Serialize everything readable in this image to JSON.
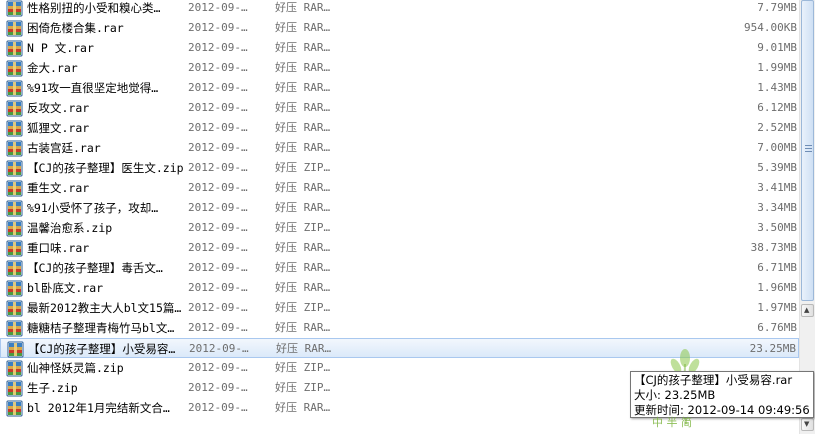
{
  "files": [
    {
      "name": "性格别扭的小受和糗心类…",
      "date": "2012-09-…",
      "type": "好压 RAR…",
      "size": "7.79MB",
      "icon": "rar-archive-icon"
    },
    {
      "name": "困倚危楼合集.rar",
      "date": "2012-09-…",
      "type": "好压 RAR…",
      "size": "954.00KB",
      "icon": "rar-archive-icon"
    },
    {
      "name": "N P 文.rar",
      "date": "2012-09-…",
      "type": "好压 RAR…",
      "size": "9.01MB",
      "icon": "rar-archive-icon"
    },
    {
      "name": "金大.rar",
      "date": "2012-09-…",
      "type": "好压 RAR…",
      "size": "1.99MB",
      "icon": "rar-archive-icon"
    },
    {
      "name": "%91攻一直很坚定地觉得…",
      "date": "2012-09-…",
      "type": "好压 RAR…",
      "size": "1.43MB",
      "icon": "rar-archive-icon"
    },
    {
      "name": "反攻文.rar",
      "date": "2012-09-…",
      "type": "好压 RAR…",
      "size": "6.12MB",
      "icon": "rar-archive-icon"
    },
    {
      "name": "狐狸文.rar",
      "date": "2012-09-…",
      "type": "好压 RAR…",
      "size": "2.52MB",
      "icon": "rar-archive-icon"
    },
    {
      "name": "古装宫廷.rar",
      "date": "2012-09-…",
      "type": "好压 RAR…",
      "size": "7.00MB",
      "icon": "rar-archive-icon"
    },
    {
      "name": "【CJ的孩子整理】医生文.zip",
      "date": "2012-09-…",
      "type": "好压 ZIP…",
      "size": "5.39MB",
      "icon": "zip-archive-icon"
    },
    {
      "name": "重生文.rar",
      "date": "2012-09-…",
      "type": "好压 RAR…",
      "size": "3.41MB",
      "icon": "rar-archive-icon"
    },
    {
      "name": "%91小受怀了孩子，攻却…",
      "date": "2012-09-…",
      "type": "好压 RAR…",
      "size": "3.34MB",
      "icon": "rar-archive-icon"
    },
    {
      "name": "温馨治愈系.zip",
      "date": "2012-09-…",
      "type": "好压 ZIP…",
      "size": "3.50MB",
      "icon": "zip-archive-icon"
    },
    {
      "name": "重口味.rar",
      "date": "2012-09-…",
      "type": "好压 RAR…",
      "size": "38.73MB",
      "icon": "rar-archive-icon"
    },
    {
      "name": "【CJ的孩子整理】毒舌文…",
      "date": "2012-09-…",
      "type": "好压 RAR…",
      "size": "6.71MB",
      "icon": "rar-archive-icon"
    },
    {
      "name": "bl卧底文.rar",
      "date": "2012-09-…",
      "type": "好压 RAR…",
      "size": "1.96MB",
      "icon": "rar-archive-icon"
    },
    {
      "name": "最新2012教主大人bl文15篇…",
      "date": "2012-09-…",
      "type": "好压 ZIP…",
      "size": "1.97MB",
      "icon": "zip-archive-icon"
    },
    {
      "name": "糖糖桔子整理青梅竹马bl文…",
      "date": "2012-09-…",
      "type": "好压 RAR…",
      "size": "6.76MB",
      "icon": "rar-archive-icon"
    },
    {
      "name": "【CJ的孩子整理】小受易容…",
      "date": "2012-09-…",
      "type": "好压 RAR…",
      "size": "23.25MB",
      "icon": "rar-archive-icon",
      "selected": true
    },
    {
      "name": "仙神怪妖灵篇.zip",
      "date": "2012-09-…",
      "type": "好压 ZIP…",
      "size": "",
      "icon": "zip-archive-icon"
    },
    {
      "name": "生子.zip",
      "date": "2012-09-…",
      "type": "好压 ZIP…",
      "size": "",
      "icon": "zip-archive-icon"
    },
    {
      "name": "bl 2012年1月完结新文合…",
      "date": "2012-09-…",
      "type": "好压 RAR…",
      "size": "",
      "icon": "rar-archive-icon"
    }
  ],
  "tooltip": {
    "line1": "【CJ的孩子整理】小受易容.rar",
    "line2": "大小: 23.25MB",
    "line3": "更新时间: 2012-09-14 09:49:56"
  },
  "watermark_text": "中 半 简",
  "colors": {
    "rar_icon_top": "#3a7fc2",
    "rar_icon_band": "#c63b2b",
    "zip_icon_band": "#c63b2b",
    "selection_bg": "#dbe9f9",
    "watermark": "#7ab33c"
  }
}
